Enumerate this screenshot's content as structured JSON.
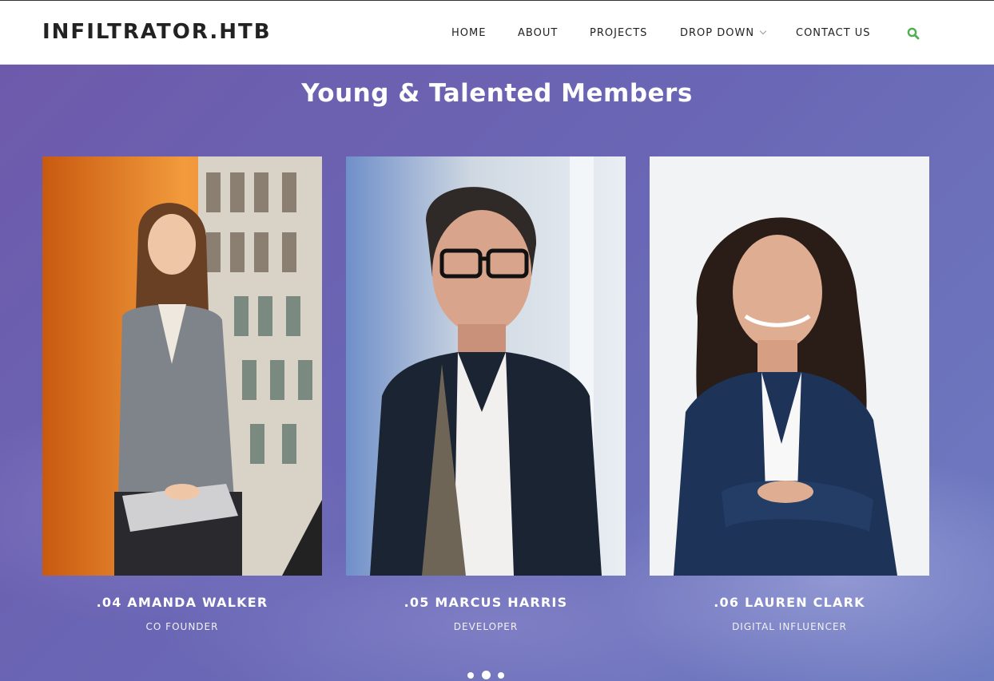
{
  "header": {
    "logo": "INFILTRATOR.HTB",
    "nav": [
      {
        "label": "HOME"
      },
      {
        "label": "ABOUT"
      },
      {
        "label": "PROJECTS"
      },
      {
        "label": "DROP DOWN"
      },
      {
        "label": "CONTACT US"
      }
    ],
    "search_icon": "search-icon",
    "accent_color": "#4caf50"
  },
  "team": {
    "title": "Young & Talented Members",
    "members": [
      {
        "name": ".04 AMANDA WALKER",
        "role": "CO FOUNDER"
      },
      {
        "name": ".05 MARCUS HARRIS",
        "role": "DEVELOPER"
      },
      {
        "name": ".06 LAUREN CLARK",
        "role": "DIGITAL INFLUENCER"
      }
    ],
    "carousel": {
      "pages": 3,
      "active": 2
    }
  }
}
